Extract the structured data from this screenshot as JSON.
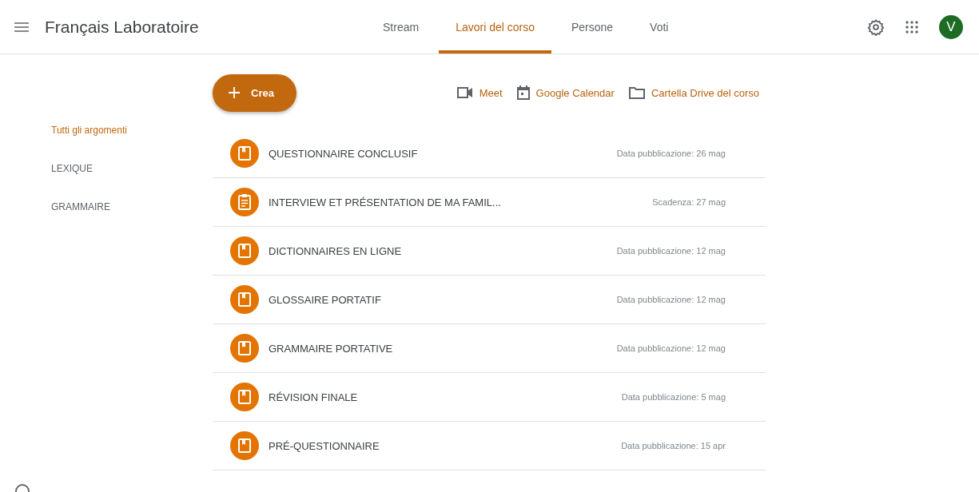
{
  "app_bar": {
    "title": "Français Laboratoire",
    "avatar": "V"
  },
  "tabs": [
    {
      "label": "Stream",
      "selected": false
    },
    {
      "label": "Lavori del corso",
      "selected": true
    },
    {
      "label": "Persone",
      "selected": false
    },
    {
      "label": "Voti",
      "selected": false
    }
  ],
  "create_button": {
    "label": "Crea"
  },
  "links": [
    {
      "kind": "meet",
      "label": "Meet"
    },
    {
      "kind": "calendar",
      "label": "Google Calendar"
    },
    {
      "kind": "folder",
      "label": "Cartella Drive del corso"
    }
  ],
  "topics": [
    {
      "label": "Tutti gli argomenti",
      "selected": true
    },
    {
      "label": "LEXIQUE",
      "selected": false
    },
    {
      "label": "GRAMMAIRE",
      "selected": false
    }
  ],
  "items": [
    {
      "kind": "material",
      "title": "QUESTIONNAIRE CONCLUSIF",
      "date": "Data pubblicazione: 26 mag"
    },
    {
      "kind": "assignment",
      "title": "INTERVIEW ET PRÉSENTATION DE MA FAMIL...",
      "date": "Scadenza: 27 mag"
    },
    {
      "kind": "material",
      "title": "DICTIONNAIRES EN LIGNE",
      "date": "Data pubblicazione: 12 mag"
    },
    {
      "kind": "material",
      "title": "GLOSSAIRE PORTATIF",
      "date": "Data pubblicazione: 12 mag"
    },
    {
      "kind": "material",
      "title": "GRAMMAIRE PORTATIVE",
      "date": "Data pubblicazione: 12 mag"
    },
    {
      "kind": "material",
      "title": "RÉVISION FINALE",
      "date": "Data pubblicazione: 5 mag"
    },
    {
      "kind": "material",
      "title": "PRÉ-QUESTIONNAIRE",
      "date": "Data pubblicazione: 15 apr"
    }
  ]
}
